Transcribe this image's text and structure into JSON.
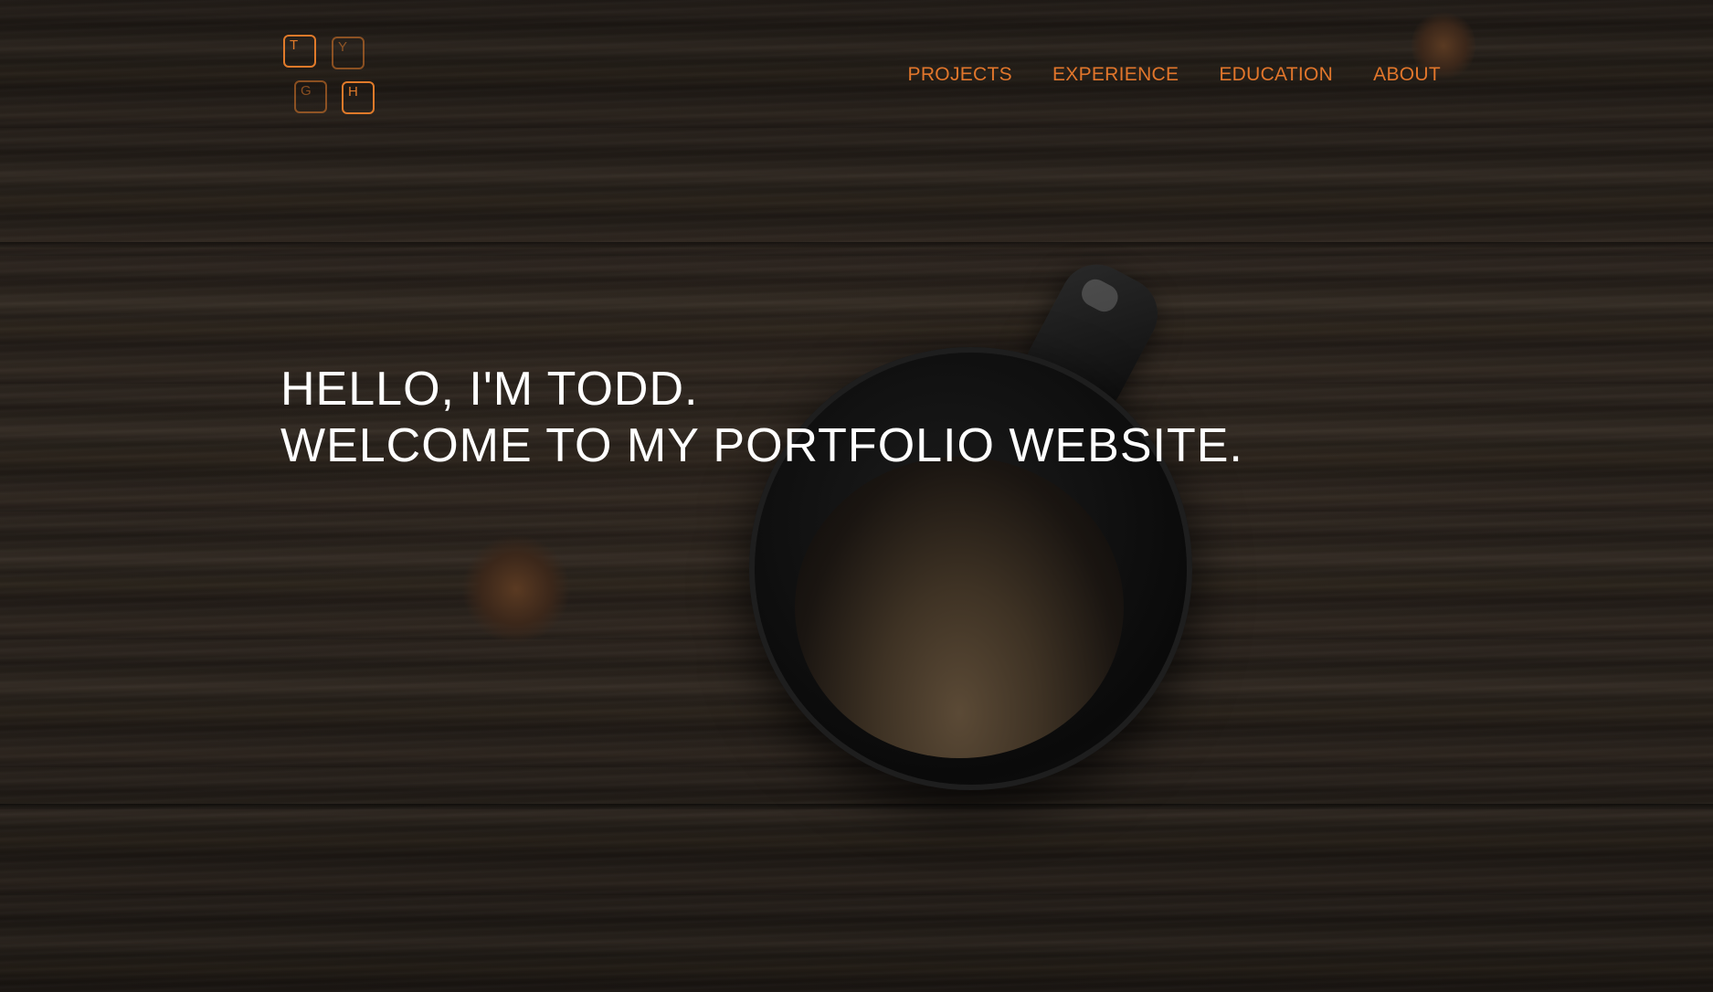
{
  "logo": {
    "keys": [
      "T",
      "Y",
      "G",
      "H"
    ]
  },
  "nav": {
    "items": [
      {
        "label": "PROJECTS"
      },
      {
        "label": "EXPERIENCE"
      },
      {
        "label": "EDUCATION"
      },
      {
        "label": "ABOUT"
      }
    ]
  },
  "hero": {
    "line1": "HELLO, I'M TODD.",
    "line2": "WELCOME TO MY PORTFOLIO WEBSITE."
  },
  "colors": {
    "accent": "#e2762b",
    "headline": "#ffffff"
  }
}
